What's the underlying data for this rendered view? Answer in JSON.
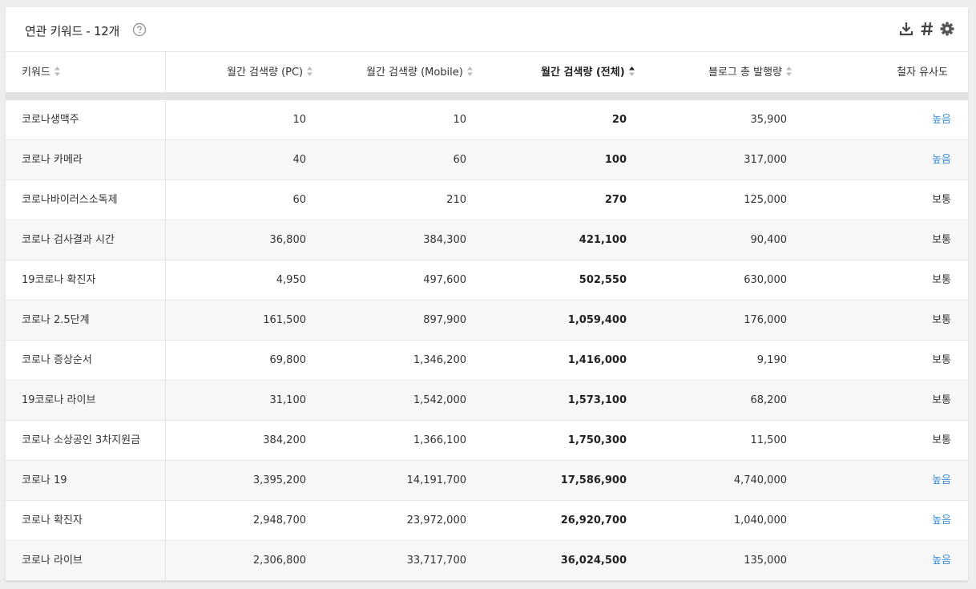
{
  "header": {
    "title": "연관 키워드 - 12개",
    "icons": [
      "help-icon",
      "download-icon",
      "hash-icon",
      "gear-icon"
    ]
  },
  "columns": {
    "keyword": "키워드",
    "pc": "월간 검색량 (PC)",
    "mobile": "월간 검색량 (Mobile)",
    "total": "월간 검색량 (전체)",
    "blog": "블로그 총 발행량",
    "similarity": "철자 유사도"
  },
  "sort": {
    "column": "total",
    "direction": "asc"
  },
  "colors": {
    "link_blue": "#3b8fd9",
    "separator": "#e2e2e2",
    "row_alt": "#f7f7f7"
  },
  "rows": [
    {
      "keyword": "코로나생맥주",
      "pc": "10",
      "mobile": "10",
      "total": "20",
      "blog": "35,900",
      "similarity": "높음"
    },
    {
      "keyword": "코로나 카메라",
      "pc": "40",
      "mobile": "60",
      "total": "100",
      "blog": "317,000",
      "similarity": "높음"
    },
    {
      "keyword": "코로나바이러스소독제",
      "pc": "60",
      "mobile": "210",
      "total": "270",
      "blog": "125,000",
      "similarity": "보통"
    },
    {
      "keyword": "코로나 검사결과 시간",
      "pc": "36,800",
      "mobile": "384,300",
      "total": "421,100",
      "blog": "90,400",
      "similarity": "보통"
    },
    {
      "keyword": "19코로나 확진자",
      "pc": "4,950",
      "mobile": "497,600",
      "total": "502,550",
      "blog": "630,000",
      "similarity": "보통"
    },
    {
      "keyword": "코로나 2.5단계",
      "pc": "161,500",
      "mobile": "897,900",
      "total": "1,059,400",
      "blog": "176,000",
      "similarity": "보통"
    },
    {
      "keyword": "코로나 증상순서",
      "pc": "69,800",
      "mobile": "1,346,200",
      "total": "1,416,000",
      "blog": "9,190",
      "similarity": "보통"
    },
    {
      "keyword": "19코로나 라이브",
      "pc": "31,100",
      "mobile": "1,542,000",
      "total": "1,573,100",
      "blog": "68,200",
      "similarity": "보통"
    },
    {
      "keyword": "코로나 소상공인 3차지원금",
      "pc": "384,200",
      "mobile": "1,366,100",
      "total": "1,750,300",
      "blog": "11,500",
      "similarity": "보통"
    },
    {
      "keyword": "코로나 19",
      "pc": "3,395,200",
      "mobile": "14,191,700",
      "total": "17,586,900",
      "blog": "4,740,000",
      "similarity": "높음"
    },
    {
      "keyword": "코로나 확진자",
      "pc": "2,948,700",
      "mobile": "23,972,000",
      "total": "26,920,700",
      "blog": "1,040,000",
      "similarity": "높음"
    },
    {
      "keyword": "코로나 라이브",
      "pc": "2,306,800",
      "mobile": "33,717,700",
      "total": "36,024,500",
      "blog": "135,000",
      "similarity": "높음"
    }
  ]
}
